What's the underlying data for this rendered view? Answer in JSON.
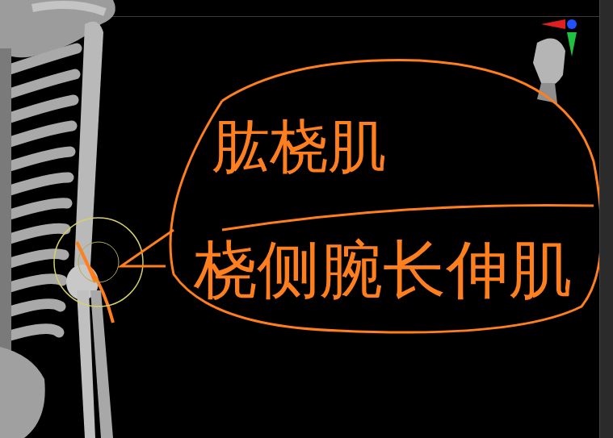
{
  "viewport": {
    "annotations": [
      {
        "text": "肱桡肌"
      },
      {
        "text": "桡侧腕长伸肌"
      }
    ]
  }
}
